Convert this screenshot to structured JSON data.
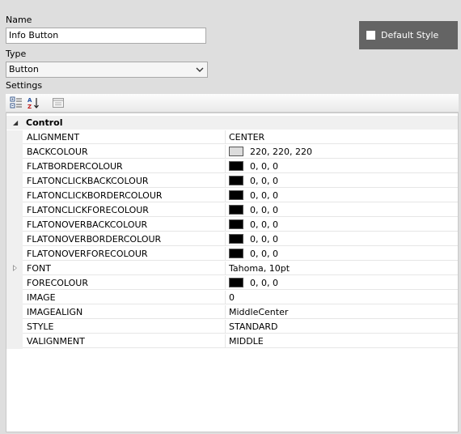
{
  "name_label": "Name",
  "name_value": "Info Button",
  "type_label": "Type",
  "type_value": "Button",
  "settings_label": "Settings",
  "default_style": {
    "label": "Default Style",
    "checked": false
  },
  "toolbar": {
    "buttons": [
      "categorized-icon",
      "alphabetical-icon",
      "property-pages-icon"
    ]
  },
  "grid": {
    "category": "Control",
    "rows": [
      {
        "name": "ALIGNMENT",
        "value": "CENTER"
      },
      {
        "name": "BACKCOLOUR",
        "value": "220, 220, 220",
        "swatch": "#dcdcdc"
      },
      {
        "name": "FLATBORDERCOLOUR",
        "value": "0, 0, 0",
        "swatch": "#000000"
      },
      {
        "name": "FLATONCLICKBACKCOLOUR",
        "value": "0, 0, 0",
        "swatch": "#000000"
      },
      {
        "name": "FLATONCLICKBORDERCOLOUR",
        "value": "0, 0, 0",
        "swatch": "#000000"
      },
      {
        "name": "FLATONCLICKFORECOLOUR",
        "value": "0, 0, 0",
        "swatch": "#000000"
      },
      {
        "name": "FLATONOVERBACKCOLOUR",
        "value": "0, 0, 0",
        "swatch": "#000000"
      },
      {
        "name": "FLATONOVERBORDERCOLOUR",
        "value": "0, 0, 0",
        "swatch": "#000000"
      },
      {
        "name": "FLATONOVERFORECOLOUR",
        "value": "0, 0, 0",
        "swatch": "#000000"
      },
      {
        "name": "FONT",
        "value": "Tahoma, 10pt",
        "expandable": true
      },
      {
        "name": "FORECOLOUR",
        "value": "0, 0, 0",
        "swatch": "#000000"
      },
      {
        "name": "IMAGE",
        "value": "0"
      },
      {
        "name": "IMAGEALIGN",
        "value": "MiddleCenter"
      },
      {
        "name": "STYLE",
        "value": "STANDARD"
      },
      {
        "name": "VALIGNMENT",
        "value": "MIDDLE"
      }
    ]
  },
  "colors": {
    "background": "#dedede",
    "default_style_bg": "#646464",
    "grid_margin": "#f0f0f0"
  }
}
